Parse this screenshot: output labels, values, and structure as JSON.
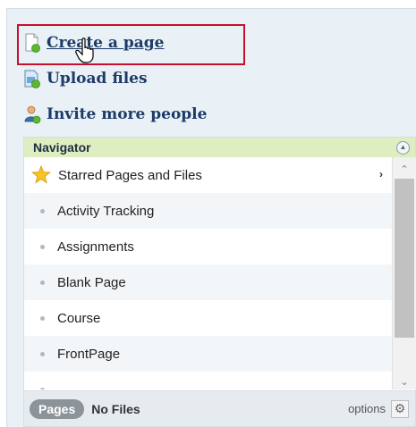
{
  "actions": {
    "create_page": "Create a page",
    "upload_files": "Upload files",
    "invite_people": "Invite more people"
  },
  "navigator": {
    "title": "Navigator",
    "items": [
      {
        "label": "Starred Pages and Files",
        "icon": "star-icon"
      },
      {
        "label": "Activity Tracking",
        "icon": "bullet-icon"
      },
      {
        "label": "Assignments",
        "icon": "bullet-icon"
      },
      {
        "label": "Blank Page",
        "icon": "bullet-icon"
      },
      {
        "label": "Course",
        "icon": "bullet-icon"
      },
      {
        "label": "FrontPage",
        "icon": "bullet-icon"
      }
    ],
    "footer": {
      "pages_tab": "Pages",
      "files_tab": "No Files",
      "options": "options"
    }
  },
  "colors": {
    "highlight": "#c8102e",
    "header_bg": "#dfeec1",
    "link": "#1c3b68"
  }
}
